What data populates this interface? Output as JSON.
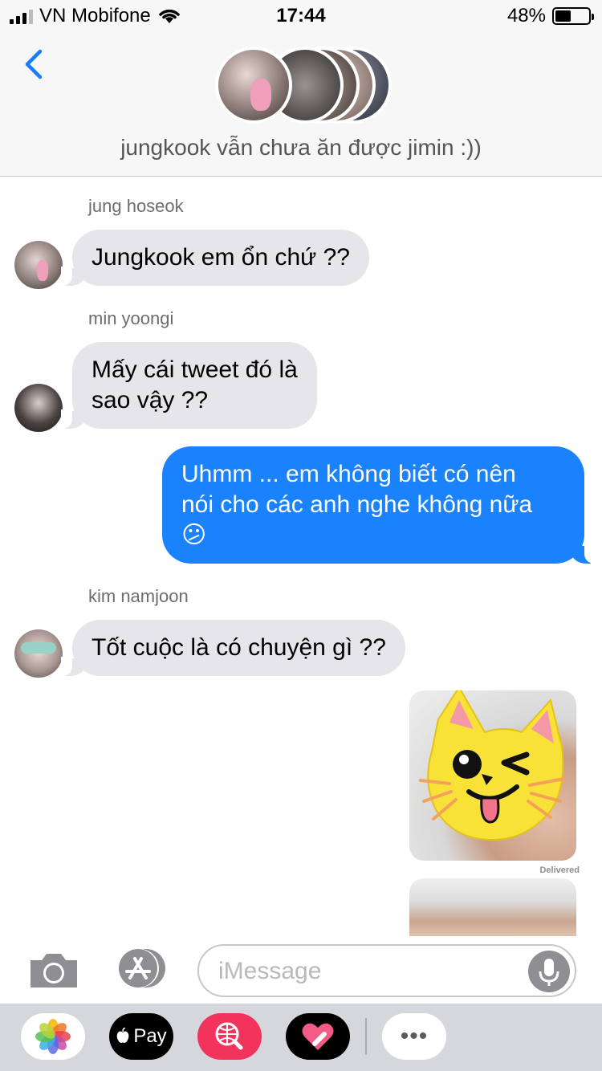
{
  "status_bar": {
    "carrier": "VN Mobifone",
    "time": "17:44",
    "battery_percent": "48%",
    "battery_level": 0.48
  },
  "header": {
    "group_title": "jungkook vẫn chưa ăn được jimin :))"
  },
  "messages": [
    {
      "sender": "jung hoseok",
      "text": "Jungkook em ổn chứ ??"
    },
    {
      "sender": "min yoongi",
      "lines": [
        "Mấy cái tweet đó là",
        "sao vậy ??"
      ]
    },
    {
      "outgoing_lines": [
        "Uhmm ... em không biết có nên",
        "nói cho các anh nghe không nữa"
      ],
      "emoji": "😕"
    },
    {
      "sender": "kim namjoon",
      "text": "Tốt cuộc là có chuyện gì ??"
    }
  ],
  "delivered_label": "Delivered",
  "input": {
    "placeholder": "iMessage"
  },
  "app_drawer": {
    "apple_pay_label": "Pay",
    "more_label": "•••"
  },
  "colors": {
    "outgoing_bubble": "#1982fc",
    "incoming_bubble": "#e5e5ea",
    "back_accent": "#1a7cf6"
  }
}
